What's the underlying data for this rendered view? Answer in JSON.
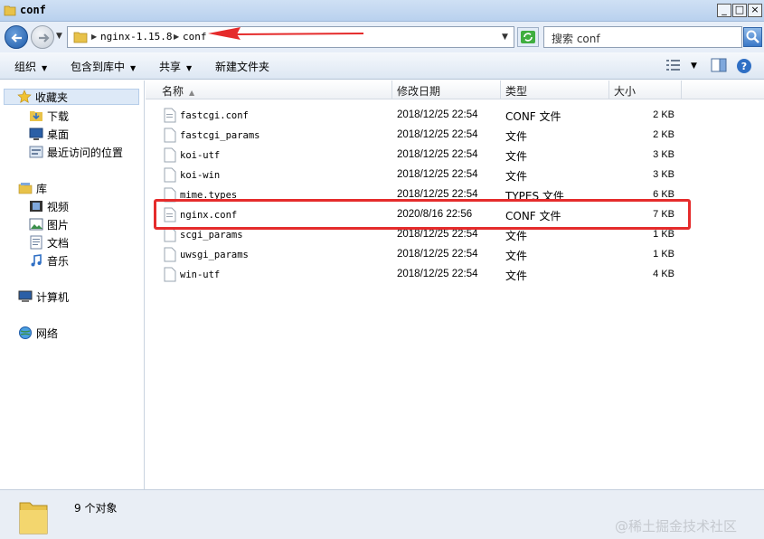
{
  "window": {
    "title": "conf",
    "controls": {
      "minimize": "_",
      "maximize": "□",
      "close": "×"
    }
  },
  "address": {
    "crumbs": [
      "nginx-1.15.8",
      "conf"
    ],
    "search_placeholder": "搜索 conf"
  },
  "toolbar": {
    "organize": "组织",
    "include_in_library": "包含到库中",
    "share": "共享",
    "new_folder": "新建文件夹"
  },
  "sidebar": {
    "favorites": {
      "label": "收藏夹",
      "items": [
        "下载",
        "桌面",
        "最近访问的位置"
      ]
    },
    "libraries": {
      "label": "库",
      "items": [
        "视频",
        "图片",
        "文档",
        "音乐"
      ]
    },
    "computer": "计算机",
    "network": "网络"
  },
  "columns": {
    "name": "名称",
    "modified": "修改日期",
    "type": "类型",
    "size": "大小"
  },
  "files": [
    {
      "name": "fastcgi.conf",
      "date": "2018/12/25 22:54",
      "type": "CONF 文件",
      "size": "2 KB"
    },
    {
      "name": "fastcgi_params",
      "date": "2018/12/25 22:54",
      "type": "文件",
      "size": "2 KB"
    },
    {
      "name": "koi-utf",
      "date": "2018/12/25 22:54",
      "type": "文件",
      "size": "3 KB"
    },
    {
      "name": "koi-win",
      "date": "2018/12/25 22:54",
      "type": "文件",
      "size": "3 KB"
    },
    {
      "name": "mime.types",
      "date": "2018/12/25 22:54",
      "type": "TYPES 文件",
      "size": "6 KB"
    },
    {
      "name": "nginx.conf",
      "date": "2020/8/16 22:56",
      "type": "CONF 文件",
      "size": "7 KB"
    },
    {
      "name": "scgi_params",
      "date": "2018/12/25 22:54",
      "type": "文件",
      "size": "1 KB"
    },
    {
      "name": "uwsgi_params",
      "date": "2018/12/25 22:54",
      "type": "文件",
      "size": "1 KB"
    },
    {
      "name": "win-utf",
      "date": "2018/12/25 22:54",
      "type": "文件",
      "size": "4 KB"
    }
  ],
  "status": {
    "count_text": "9 个对象"
  },
  "watermark": "@稀土掘金技术社区",
  "annotations": {
    "highlight_color": "#e52b2b"
  }
}
